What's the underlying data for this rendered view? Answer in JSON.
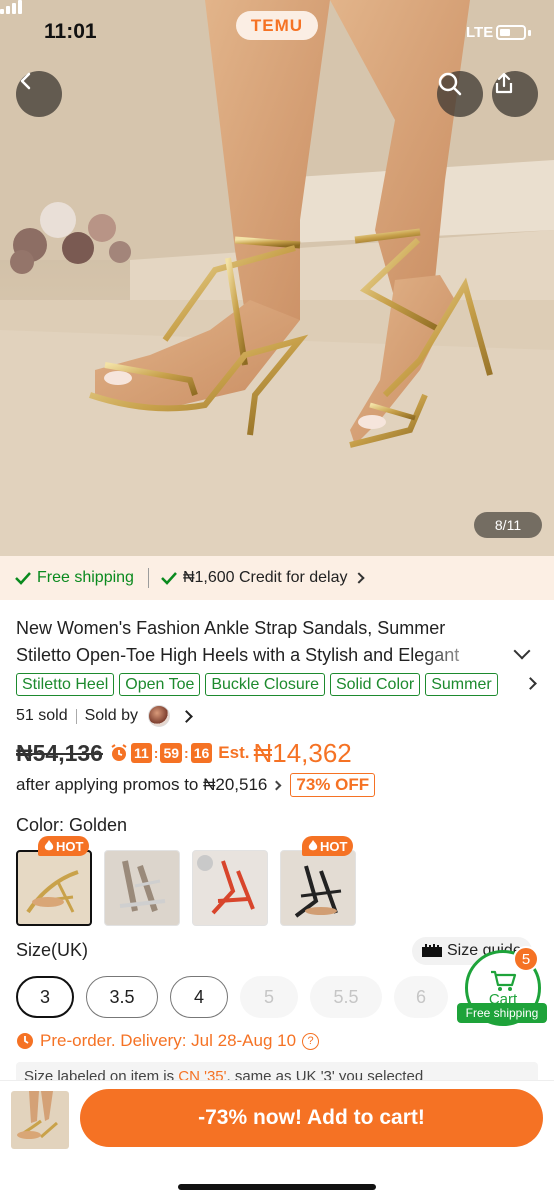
{
  "status": {
    "time": "11:01",
    "network": "LTE"
  },
  "brand": "TEMU",
  "gallery": {
    "counter": "8/11",
    "current": 8,
    "total": 11
  },
  "shipping": {
    "free_label": "Free shipping",
    "credit_label": "₦1,600 Credit for delay"
  },
  "product": {
    "title": "New Women's Fashion Ankle Strap Sandals, Summer Stiletto Open-Toe High Heels with a Stylish and Elegant",
    "tags": [
      "Stiletto Heel",
      "Open Toe",
      "Buckle Closure",
      "Solid Color",
      "Summer"
    ],
    "sold": "51 sold",
    "sold_by": "Sold by"
  },
  "price": {
    "original": "₦54,136",
    "timer": {
      "hours": "11",
      "minutes": "59",
      "seconds": "16"
    },
    "est_label": "Est.",
    "est_price": "₦14,362",
    "promo_text": "after applying promos to ₦20,516",
    "discount_badge": "73% OFF"
  },
  "color": {
    "label": "Color: Golden",
    "options": [
      {
        "name": "Golden",
        "hot": true,
        "hot_label": "HOT",
        "selected": true,
        "swatch": "#c9a24a"
      },
      {
        "name": "Silver",
        "hot": false,
        "selected": false,
        "swatch": "#c8c8c8"
      },
      {
        "name": "Red",
        "hot": false,
        "selected": false,
        "swatch": "#d8452c"
      },
      {
        "name": "Black",
        "hot": true,
        "hot_label": "HOT",
        "selected": false,
        "swatch": "#222222"
      }
    ]
  },
  "size": {
    "label": "Size(UK)",
    "guide_label": "Size guide",
    "options": [
      {
        "value": "3",
        "state": "selected"
      },
      {
        "value": "3.5",
        "state": "available"
      },
      {
        "value": "4",
        "state": "available"
      },
      {
        "value": "5",
        "state": "disabled"
      },
      {
        "value": "5.5",
        "state": "disabled"
      },
      {
        "value": "6",
        "state": "disabled"
      }
    ]
  },
  "cart": {
    "label": "Cart",
    "count": "5",
    "shipping_badge": "Free shipping"
  },
  "preorder": {
    "text": "Pre-order. Delivery: Jul 28-Aug 10"
  },
  "size_note": {
    "prefix": "Size labeled on item is ",
    "highlight": "CN '35'",
    "suffix": ", same as UK '3' you selected"
  },
  "bottom": {
    "add_to_cart": "-73% now! Add to cart!"
  },
  "colors": {
    "accent": "#f57224",
    "green": "#1d8a2e",
    "ship_bar_bg": "#fcefe4"
  }
}
